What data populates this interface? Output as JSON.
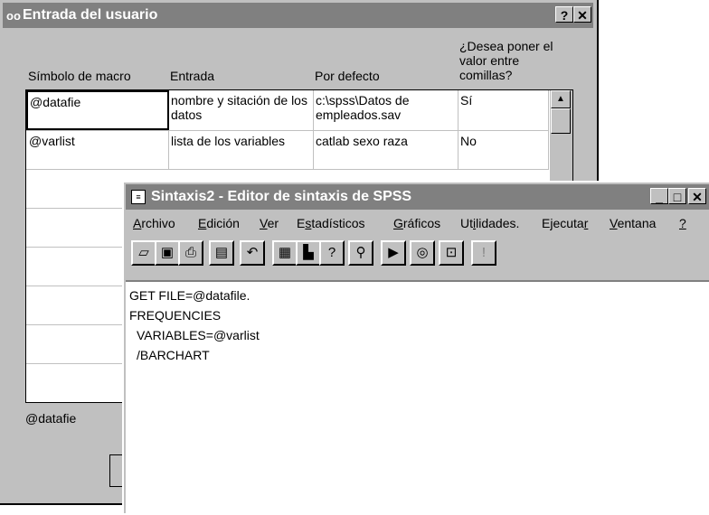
{
  "dialog": {
    "title": "Entrada del usuario",
    "title_buttons": [
      "?",
      "✕"
    ],
    "columns": [
      "Símbolo de macro",
      "Entrada",
      "Por defecto",
      "¿Desea poner el valor entre comillas?"
    ],
    "rows": [
      {
        "symbol": "@datafie",
        "input": "nombre y sitación de los datos",
        "default": "c:\\spss\\Datos de empleados.sav",
        "quote": "Sí"
      },
      {
        "symbol": "@varlist",
        "input": "lista de los variables",
        "default": "catlab sexo raza",
        "quote": "No"
      }
    ],
    "footer_value": "@datafie"
  },
  "editor_window": {
    "title": "Sintaxis2 - Editor de sintaxis de SPSS",
    "menu": [
      {
        "pre": "",
        "u": "A",
        "post": "rchivo"
      },
      {
        "pre": "",
        "u": "E",
        "post": "dición"
      },
      {
        "pre": "",
        "u": "V",
        "post": "er"
      },
      {
        "pre": "E",
        "u": "s",
        "post": "tadísticos"
      },
      {
        "pre": "",
        "u": "G",
        "post": "ráficos"
      },
      {
        "pre": "Ut",
        "u": "i",
        "post": "lidades."
      },
      {
        "pre": "Ejecuta",
        "u": "r",
        "post": ""
      },
      {
        "pre": "",
        "u": "V",
        "post": "entana"
      },
      {
        "pre": "",
        "u": "?",
        "post": ""
      }
    ],
    "toolbar_icons": [
      "open-icon",
      "save-icon",
      "print-icon",
      "dialog-recall-icon",
      "undo-icon",
      "goto-data-icon",
      "goto-chart-icon",
      "variables-icon",
      "find-icon",
      "run-icon",
      "use-sets-icon",
      "designate-window-icon",
      "help-icon"
    ],
    "code": [
      "GET FILE=@datafile.",
      "FREQUENCIES",
      "  VARIABLES=@varlist",
      "  /BARCHART"
    ]
  }
}
